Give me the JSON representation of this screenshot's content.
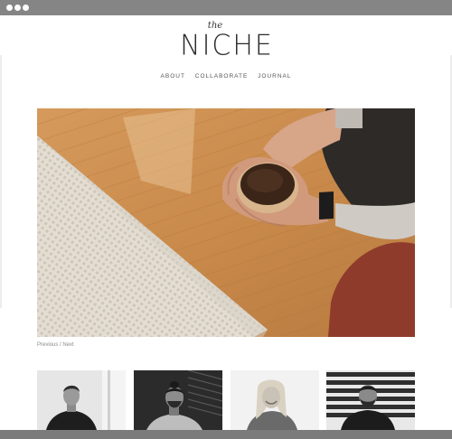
{
  "browser": {
    "window_dots": [
      "close",
      "minimize",
      "maximize"
    ]
  },
  "site": {
    "logo_small": "the",
    "logo_main": "NICHE",
    "nav": [
      "ABOUT",
      "COLLABORATE",
      "JOURNAL"
    ]
  },
  "hero": {
    "image": "hands-holding-coffee-cup-photo"
  },
  "pager": {
    "previous": "Previous",
    "separator": "/",
    "next": "Next"
  },
  "thumbnails": [
    {
      "image": "portrait-man-short-hair"
    },
    {
      "image": "portrait-man-bun"
    },
    {
      "image": "portrait-woman-blonde-smiling"
    },
    {
      "image": "portrait-man-beard-jacket"
    }
  ]
}
